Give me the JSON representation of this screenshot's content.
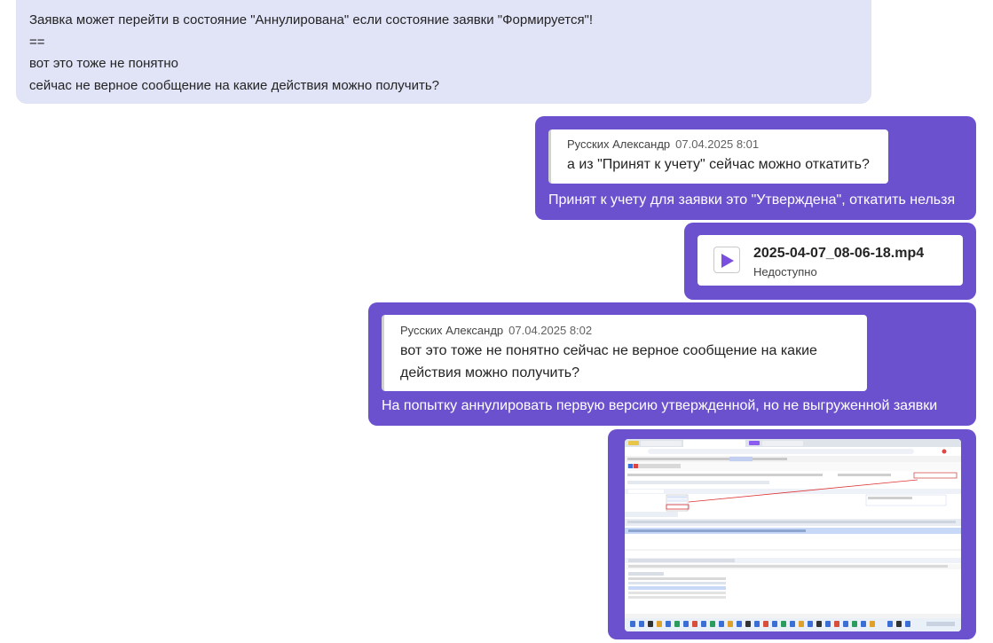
{
  "incoming": {
    "lines": [
      "Заявка может перейти в состояние \"Аннулирована\" если состояние заявки \"Формируется\"!",
      "==",
      "вот это тоже не понятно",
      "сейчас не верное сообщение на какие действия можно получить?"
    ]
  },
  "messages": [
    {
      "quote_author": "Русских Александр",
      "quote_time": "07.04.2025 8:01",
      "quote_text": "а из \"Принят к учету\" сейчас можно откатить?",
      "reply": "Принят к учету для заявки это \"Утверждена\", откатить нельзя"
    },
    {
      "file_name": "2025-04-07_08-06-18.mp4",
      "file_status": "Недоступно",
      "file_icon": "play-icon"
    },
    {
      "quote_author": "Русских Александр",
      "quote_time": "07.04.2025 8:02",
      "quote_text": "вот это тоже не понятно сейчас не верное сообщение на какие действия можно получить?",
      "reply": "На попытку аннулировать первую версию утвержденной, но не выгруженной заявки"
    }
  ],
  "colors": {
    "outgoing_bubble": "#6c51cf",
    "incoming_bubble": "#e1e3f7",
    "play_icon": "#7a4fe0"
  }
}
